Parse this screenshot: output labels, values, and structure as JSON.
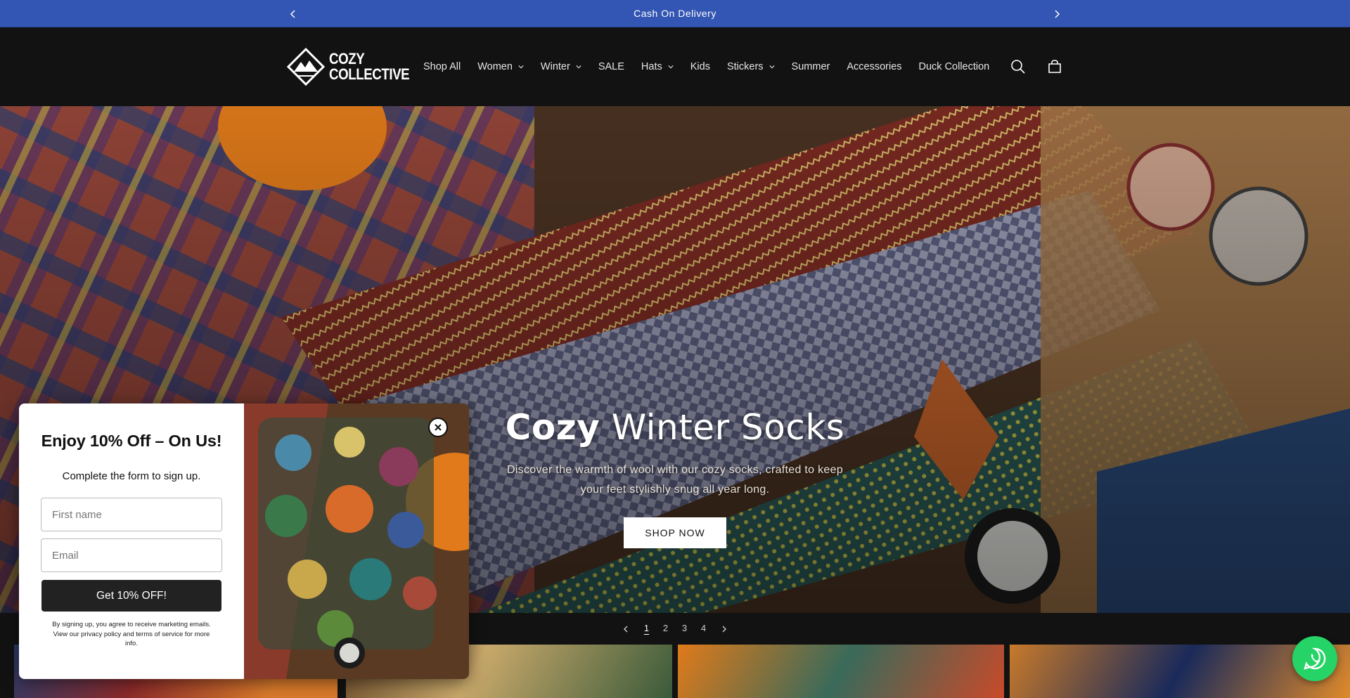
{
  "announcement": {
    "text": "Cash On Delivery",
    "prev_icon": "chevron-left-icon",
    "next_icon": "chevron-right-icon"
  },
  "header": {
    "logo_line1": "COZY",
    "logo_line2": "COLLECTIVE",
    "nav": [
      {
        "label": "Shop All",
        "has_dropdown": false
      },
      {
        "label": "Women",
        "has_dropdown": true
      },
      {
        "label": "Winter",
        "has_dropdown": true
      },
      {
        "label": "SALE",
        "has_dropdown": false
      },
      {
        "label": "Hats",
        "has_dropdown": true
      },
      {
        "label": "Kids",
        "has_dropdown": false
      },
      {
        "label": "Stickers",
        "has_dropdown": true
      },
      {
        "label": "Summer",
        "has_dropdown": false
      },
      {
        "label": "Accessories",
        "has_dropdown": false
      },
      {
        "label": "Duck Collection",
        "has_dropdown": false
      }
    ],
    "icons": [
      "search-icon",
      "cart-icon"
    ]
  },
  "hero": {
    "title_bold": "Cozy",
    "title_rest": " Winter Socks",
    "subtitle": "Discover the warmth of wool with our cozy socks, crafted to keep your feet stylishly snug all year long.",
    "button_label": "SHOP NOW"
  },
  "slider": {
    "pages": [
      "1",
      "2",
      "3",
      "4"
    ],
    "current": "1"
  },
  "popup": {
    "title": "Enjoy 10% Off – On Us!",
    "subtitle": "Complete the form to sign up.",
    "first_name_placeholder": "First name",
    "email_placeholder": "Email",
    "submit_label": "Get 10% OFF!",
    "legal": "By signing up, you agree to receive marketing emails. View our privacy policy and terms of service for more info."
  },
  "colors": {
    "announcement_bg": "#3355b3",
    "header_bg": "#121212",
    "whatsapp": "#25d366"
  }
}
